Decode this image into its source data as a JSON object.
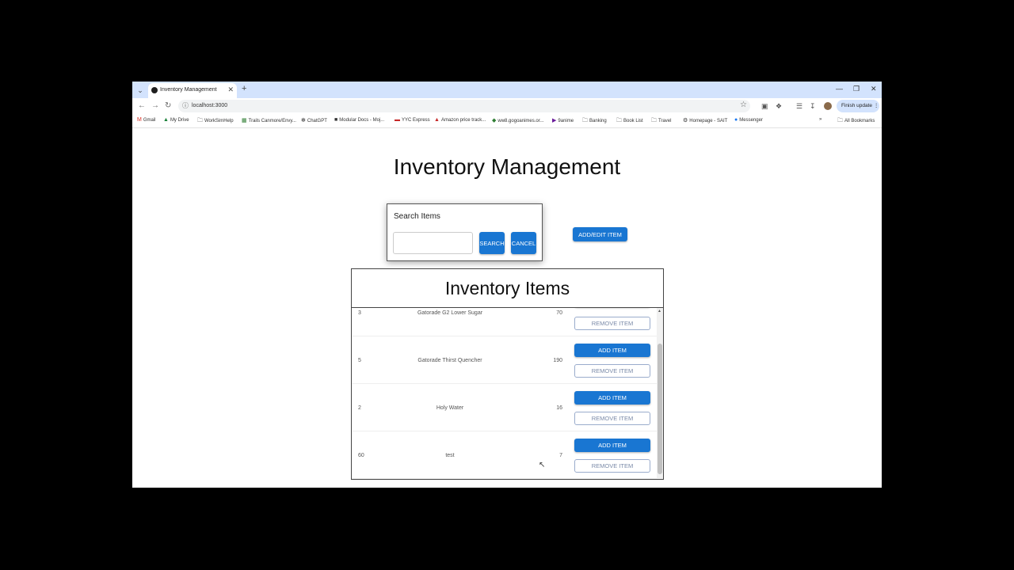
{
  "browser": {
    "tab_title": "Inventory Management",
    "url": "localhost:3000",
    "update_label": "Finish update",
    "bookmarks": [
      "Gmail",
      "My Drive",
      "WorkSimHelp",
      "Trails Canmore/Envy...",
      "ChatGPT",
      "Modular Docs - Moj...",
      "YYC Express",
      "Amazon price track...",
      "ww8.gogoanimes.or...",
      "9anime",
      "Banking",
      "Book List",
      "Travel",
      "Homepage - SAIT",
      "Messenger"
    ],
    "all_bookmarks": "All Bookmarks"
  },
  "page": {
    "title": "Inventory Management",
    "search": {
      "label": "Search Items",
      "value": "",
      "search_button": "SEARCH",
      "cancel_button": "CANCEL"
    },
    "add_edit_button": "ADD/EDIT ITEM",
    "inventory": {
      "title": "Inventory Items",
      "add_label": "ADD ITEM",
      "remove_label": "REMOVE ITEM",
      "rows": [
        {
          "id": "3",
          "name": "Gatorade G2 Lower Sugar",
          "qty": "70"
        },
        {
          "id": "5",
          "name": "Gatorade Thirst Quencher",
          "qty": "190"
        },
        {
          "id": "2",
          "name": "Holy Water",
          "qty": "16"
        },
        {
          "id": "60",
          "name": "test",
          "qty": "7"
        }
      ]
    }
  },
  "colors": {
    "primary": "#1976d2",
    "tabstrip": "#d3e3fd"
  }
}
